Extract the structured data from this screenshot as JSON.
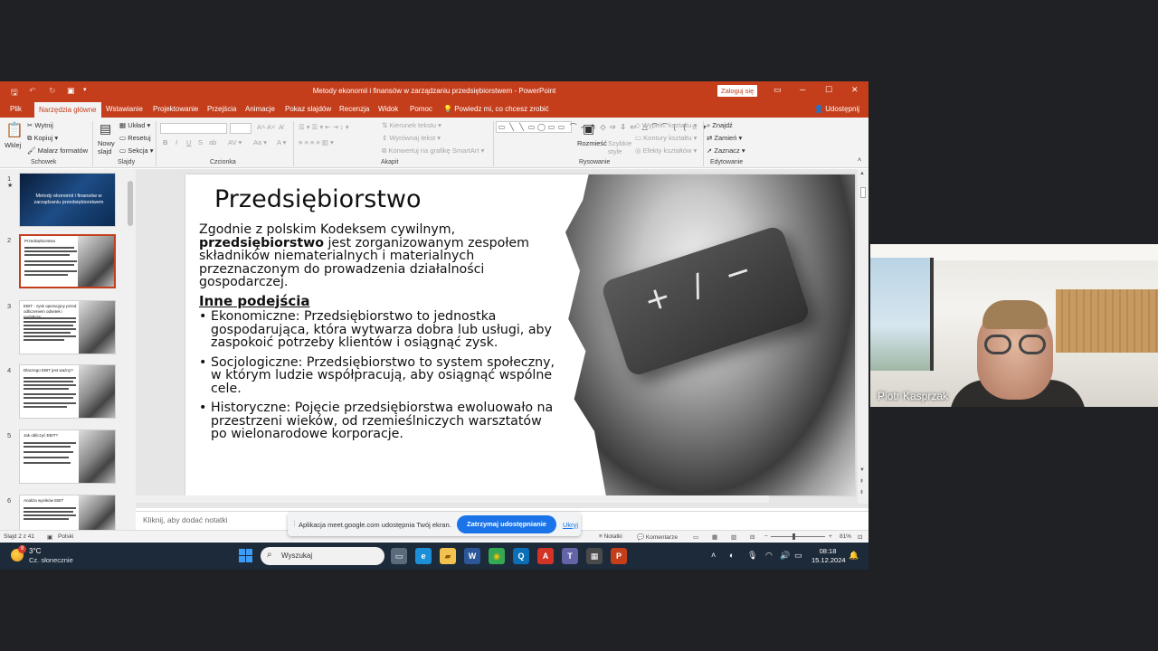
{
  "window": {
    "title": "Metody ekonomii i finansów w zarządzaniu przedsiębiorstwem  -  PowerPoint",
    "login_label": "Zaloguj się",
    "controls": [
      "─",
      "☐",
      "✕"
    ]
  },
  "tabs": [
    {
      "label": "Plik"
    },
    {
      "label": "Narzędzia główne"
    },
    {
      "label": "Wstawianie"
    },
    {
      "label": "Projektowanie"
    },
    {
      "label": "Przejścia"
    },
    {
      "label": "Animacje"
    },
    {
      "label": "Pokaz slajdów"
    },
    {
      "label": "Recenzja"
    },
    {
      "label": "Widok"
    },
    {
      "label": "Pomoc"
    }
  ],
  "tell_me": "Powiedz mi, co chcesz zrobić",
  "share_label": "Udostępnij",
  "ribbon": {
    "clipboard": {
      "paste": "Wklej",
      "cut": "Wytnij",
      "copy": "Kopiuj",
      "format_painter": "Malarz formatów",
      "group": "Schowek"
    },
    "slides": {
      "new_slide": "Nowy slajd",
      "layout": "Układ",
      "reset": "Resetuj",
      "section": "Sekcja",
      "group": "Slajdy"
    },
    "font": {
      "group": "Czcionka",
      "bold": "B",
      "italic": "I",
      "underline": "U",
      "strike": "S",
      "shadow": "ab"
    },
    "paragraph": {
      "text_direction": "Kierunek tekstu",
      "align_text": "Wyrównaj tekst",
      "smartart": "Konwertuj na grafikę SmartArt",
      "group": "Akapit"
    },
    "drawing": {
      "arrange": "Rozmieść",
      "quick_styles": "Szybkie style",
      "fill": "Wypełn. kształtu",
      "outline": "Kontury kształtu",
      "effects": "Efekty kształtów",
      "group": "Rysowanie"
    },
    "editing": {
      "find": "Znajdź",
      "replace": "Zamień",
      "select": "Zaznacz",
      "group": "Edytowanie"
    }
  },
  "thumbnails": [
    {
      "num": "1",
      "title": "Metody ekonomii i finansów w zarządzaniu przedsiębiorstwem",
      "selected": false
    },
    {
      "num": "2",
      "title": "Przedsiębiorstwo",
      "selected": true
    },
    {
      "num": "3",
      "title": "EBIT - zysk operacyjny przed odliczeniem odsetek i podatków",
      "selected": false
    },
    {
      "num": "4",
      "title": "Dlaczego EBIT jest ważny?",
      "selected": false
    },
    {
      "num": "5",
      "title": "Jak obliczyć EBIT?",
      "selected": false
    },
    {
      "num": "6",
      "title": "Analiza wyników EBIT",
      "selected": false
    }
  ],
  "slide": {
    "title": "Przedsiębiorstwo",
    "intro_1": "Zgodnie z polskim Kodeksem cywilnym,",
    "intro_bold": "przedsiębiorstwo",
    "intro_2": " jest zorganizowanym zespołem składników niematerialnych i materialnych przeznaczonym do prowadzenia działalności gospodarczej.",
    "heading": "Inne podejścia",
    "bullets": [
      "Ekonomiczne: Przedsiębiorstwo to jednostka gospodarująca, która wytwarza dobra lub usługi, aby zaspokoić potrzeby klientów i osiągnąć zysk.",
      "Socjologiczne: Przedsiębiorstwo to system społeczny, w którym ludzie współpracują, aby osiągnąć wspólne cele.",
      "Historyczne: Pojęcie przedsiębiorstwa ewoluowało na przestrzeni wieków, od rzemieślniczych warsztatów po wielonarodowe korporacje."
    ],
    "key_symbols": "+ / −"
  },
  "notes_placeholder": "Kliknij, aby dodać notatki",
  "statusbar": {
    "slide_info": "Slajd 2 z 41",
    "language": "Polski",
    "notes": "Notatki",
    "comments": "Komentarze",
    "zoom": "81%"
  },
  "meet_banner": {
    "message": "Aplikacja meet.google.com udostępnia Twój ekran.",
    "stop_label": "Zatrzymaj udostępnianie",
    "hide_label": "Ukryj"
  },
  "taskbar": {
    "temperature": "3°C",
    "condition": "Cz. słonecznie",
    "weather_badge": "9",
    "search_placeholder": "Wyszukaj",
    "time": "08:18",
    "date": "15.12.2024",
    "apps": [
      {
        "icon": "task-view-icon",
        "glyph": "▭",
        "bg": "#5a6b7d",
        "color": "#fff"
      },
      {
        "icon": "edge-icon",
        "glyph": "e",
        "bg": "#1d8fd8",
        "color": "#fff"
      },
      {
        "icon": "file-explorer-icon",
        "glyph": "▰",
        "bg": "#f2c14e",
        "color": "#8a5a00"
      },
      {
        "icon": "word-icon",
        "glyph": "W",
        "bg": "#2b579a",
        "color": "#fff"
      },
      {
        "icon": "chrome-icon",
        "glyph": "◉",
        "bg": "#34a853",
        "color": "#fbbc05"
      },
      {
        "icon": "search-app-icon",
        "glyph": "Q",
        "bg": "#0b6fb8",
        "color": "#fff"
      },
      {
        "icon": "pdf-icon",
        "glyph": "A",
        "bg": "#d23327",
        "color": "#fff"
      },
      {
        "icon": "teams-icon",
        "glyph": "T",
        "bg": "#6264a7",
        "color": "#fff"
      },
      {
        "icon": "calculator-icon",
        "glyph": "▦",
        "bg": "#4a4a4a",
        "color": "#fff"
      },
      {
        "icon": "powerpoint-icon",
        "glyph": "P",
        "bg": "#c43e1c",
        "color": "#fff"
      }
    ]
  },
  "participant": {
    "name": "Piotr Kasprzak"
  }
}
